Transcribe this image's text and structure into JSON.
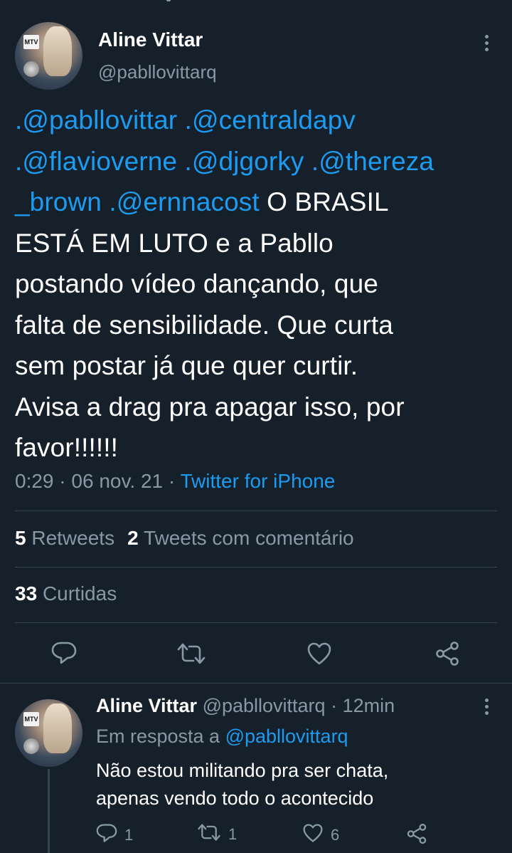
{
  "main_tweet": {
    "author_name": "Aline Vittar",
    "author_handle": "@pabllovittarq",
    "avatar_badge": "MTV",
    "text_parts": {
      "m1": ".@pabllovittar",
      "m2": ".@centraldapv",
      "m3": ".@flavioverne",
      "m4": ".@djgorky",
      "m5a": ".@thereza",
      "m5b": "_brown",
      "m6": ".@ernnacost",
      "body_line1": "O BRASIL",
      "body_line2": "ESTÁ EM LUTO e a Pabllo",
      "body_line3": "postando vídeo dançando, que",
      "body_line4": "falta de sensibilidade. Que curta",
      "body_line5": "sem postar já que quer curtir.",
      "body_line6": "Avisa a drag pra apagar isso, por",
      "body_line7": "favor!!!!!!"
    },
    "time": "0:29",
    "separator": " · ",
    "date": "06 nov. 21",
    "source": "Twitter for iPhone",
    "retweets_count": "5",
    "retweets_label": "Retweets",
    "quotes_count": "2",
    "quotes_label": "Tweets com comentário",
    "likes_count": "33",
    "likes_label": "Curtidas"
  },
  "reply": {
    "author_name": "Aline Vittar",
    "author_handle": "@pabllovittarq",
    "separator": " · ",
    "time_ago": "12min",
    "replying_prefix": "Em resposta a ",
    "replying_to": "@pabllovittarq",
    "text_line1": "Não estou militando pra ser chata,",
    "text_line2": "apenas vendo todo o acontecido",
    "reply_count": "1",
    "retweet_count": "1",
    "like_count": "6"
  },
  "colors": {
    "background": "#15202b",
    "accent": "#1d9bf0",
    "secondary_text": "#8899a6",
    "divider": "#38444d"
  },
  "icons": [
    "reply-icon",
    "retweet-icon",
    "like-icon",
    "share-icon",
    "more-icon"
  ]
}
